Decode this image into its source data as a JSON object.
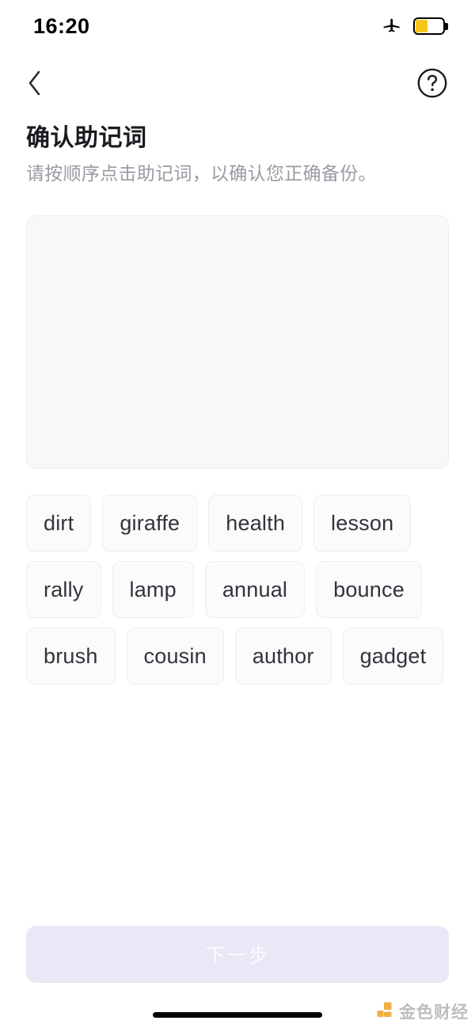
{
  "status_bar": {
    "time": "16:20",
    "airplane_icon": "airplane-mode-icon",
    "battery_icon": "battery-low-power-icon",
    "battery_level_percent": 40,
    "battery_color": "#F6C618"
  },
  "nav_bar": {
    "back_icon": "chevron-left-icon",
    "help_icon": "question-mark-circle-icon"
  },
  "header": {
    "title": "确认助记词",
    "subtitle": "请按顺序点击助记词，以确认您正确备份。"
  },
  "answer_box": {
    "selected_words": [],
    "background_color": "#F8F8F9"
  },
  "word_pool": {
    "words": [
      "dirt",
      "giraffe",
      "health",
      "lesson",
      "rally",
      "lamp",
      "annual",
      "bounce",
      "brush",
      "cousin",
      "author",
      "gadget"
    ]
  },
  "footer": {
    "next_button_label": "下一步",
    "next_button_enabled": false,
    "next_button_color": "#E8E8F6"
  },
  "watermark": {
    "text": "金色财经",
    "logo_color": "#F0A830"
  }
}
